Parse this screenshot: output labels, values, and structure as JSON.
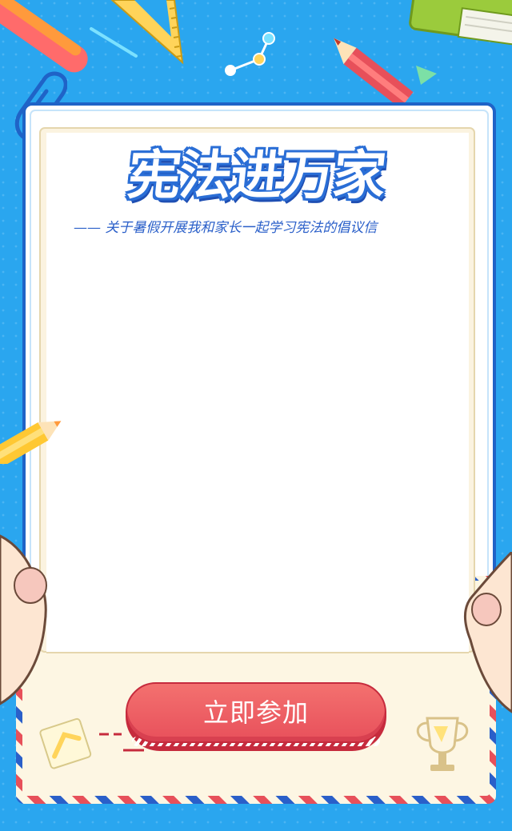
{
  "page": {
    "title": "宪法进万家",
    "subtitle": "—— 关于暑假开展我和家长一起学习宪法的倡议信"
  },
  "cta": {
    "label": "立即参加"
  },
  "colors": {
    "background": "#2aa6ef",
    "title_outline": "#2a6ed6",
    "subtitle": "#2a5fc9",
    "button": "#e8505b",
    "envelope": "#fdf6e3",
    "airmail_red": "#e7505a",
    "airmail_blue": "#2a5fc9"
  },
  "icons": [
    "pencil-icon",
    "ruler-icon",
    "book-icon",
    "paperclip-icon",
    "molecule-icon",
    "trophy-icon",
    "note-icon"
  ]
}
